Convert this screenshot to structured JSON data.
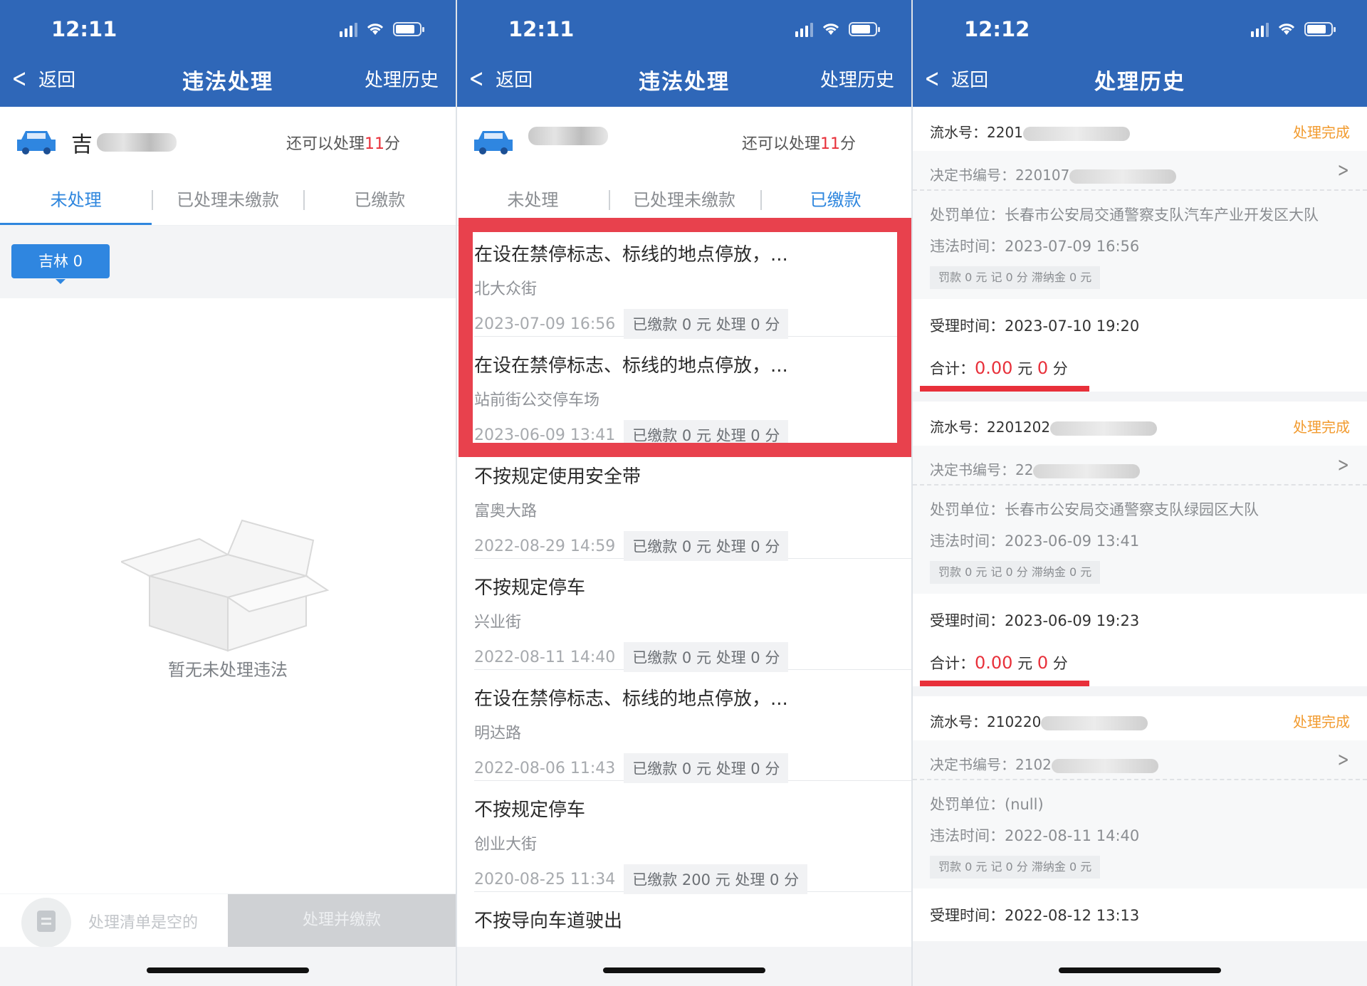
{
  "screens": [
    {
      "status": {
        "time": "12:11"
      },
      "nav": {
        "back": "返回",
        "title": "违法处理",
        "right": "处理历史"
      },
      "vehicle": {
        "plate": "吉",
        "quota_prefix": "还可以处理",
        "quota_num": "11",
        "quota_unit": "分"
      },
      "tabs": [
        "未处理",
        "已处理未缴款",
        "已缴款"
      ],
      "active_tab": 0,
      "region_chip": "吉林 0",
      "empty_text": "暂无未处理违法",
      "bottom": {
        "cart_text": "处理清单是空的",
        "pay_button": "处理并缴款"
      }
    },
    {
      "status": {
        "time": "12:11"
      },
      "nav": {
        "back": "返回",
        "title": "违法处理",
        "right": "处理历史"
      },
      "vehicle": {
        "quota_prefix": "还可以处理",
        "quota_num": "11",
        "quota_unit": "分"
      },
      "tabs": [
        "未处理",
        "已处理未缴款",
        "已缴款"
      ],
      "active_tab": 2,
      "records": [
        {
          "title": "在设在禁停标志、标线的地点停放，...",
          "location": "北大众街",
          "time": "2023-07-09 16:56",
          "tag": "已缴款 0 元  处理 0 分"
        },
        {
          "title": "在设在禁停标志、标线的地点停放，...",
          "location": "站前街公交停车场",
          "time": "2023-06-09 13:41",
          "tag": "已缴款 0 元  处理 0 分"
        },
        {
          "title": "不按规定使用安全带",
          "location": "富奥大路",
          "time": "2022-08-29 14:59",
          "tag": "已缴款 0 元  处理 0 分"
        },
        {
          "title": "不按规定停车",
          "location": "兴业街",
          "time": "2022-08-11 14:40",
          "tag": "已缴款 0 元  处理 0 分"
        },
        {
          "title": "在设在禁停标志、标线的地点停放，...",
          "location": "明达路",
          "time": "2022-08-06 11:43",
          "tag": "已缴款 0 元  处理 0 分"
        },
        {
          "title": "不按规定停车",
          "location": "创业大街",
          "time": "2020-08-25 11:34",
          "tag": "已缴款 200 元  处理 0 分"
        },
        {
          "title": "不按导向车道驶出",
          "location": "",
          "time": "",
          "tag": ""
        }
      ]
    },
    {
      "status": {
        "time": "12:12"
      },
      "nav": {
        "back": "返回",
        "title": "处理历史"
      },
      "history": [
        {
          "serial": "流水号：2201",
          "status": "处理完成",
          "decision": "决定书编号：220107",
          "unit": "处罚单位：长春市公安局交通警察支队汽车产业开发区大队",
          "violation_time": "违法时间：2023-07-09 16:56",
          "fines": "罚款 0 元  记 0 分  滞纳金 0 元",
          "accept_time": "受理时间：2023-07-10 19:20",
          "total_label": "合计：",
          "total_money": "0.00",
          "total_money_unit": "元",
          "total_points": "0",
          "total_points_unit": "分"
        },
        {
          "serial": "流水号：2201202",
          "status": "处理完成",
          "decision": "决定书编号：22",
          "unit": "处罚单位：长春市公安局交通警察支队绿园区大队",
          "violation_time": "违法时间：2023-06-09 13:41",
          "fines": "罚款 0 元  记 0 分  滞纳金 0 元",
          "accept_time": "受理时间：2023-06-09 19:23",
          "total_label": "合计：",
          "total_money": "0.00",
          "total_money_unit": "元",
          "total_points": "0",
          "total_points_unit": "分"
        },
        {
          "serial": "流水号：210220",
          "status": "处理完成",
          "decision": "决定书编号：2102",
          "unit": "处罚单位：(null)",
          "violation_time": "违法时间：2022-08-11 14:40",
          "fines": "罚款 0 元  记 0 分  滞纳金 0 元",
          "accept_time": "受理时间：2022-08-12 13:13"
        }
      ]
    }
  ],
  "colors": {
    "nav_blue": "#2f67b8",
    "accent_blue": "#2e86de",
    "highlight_red": "#e8414d",
    "status_orange": "#f29b2f"
  }
}
